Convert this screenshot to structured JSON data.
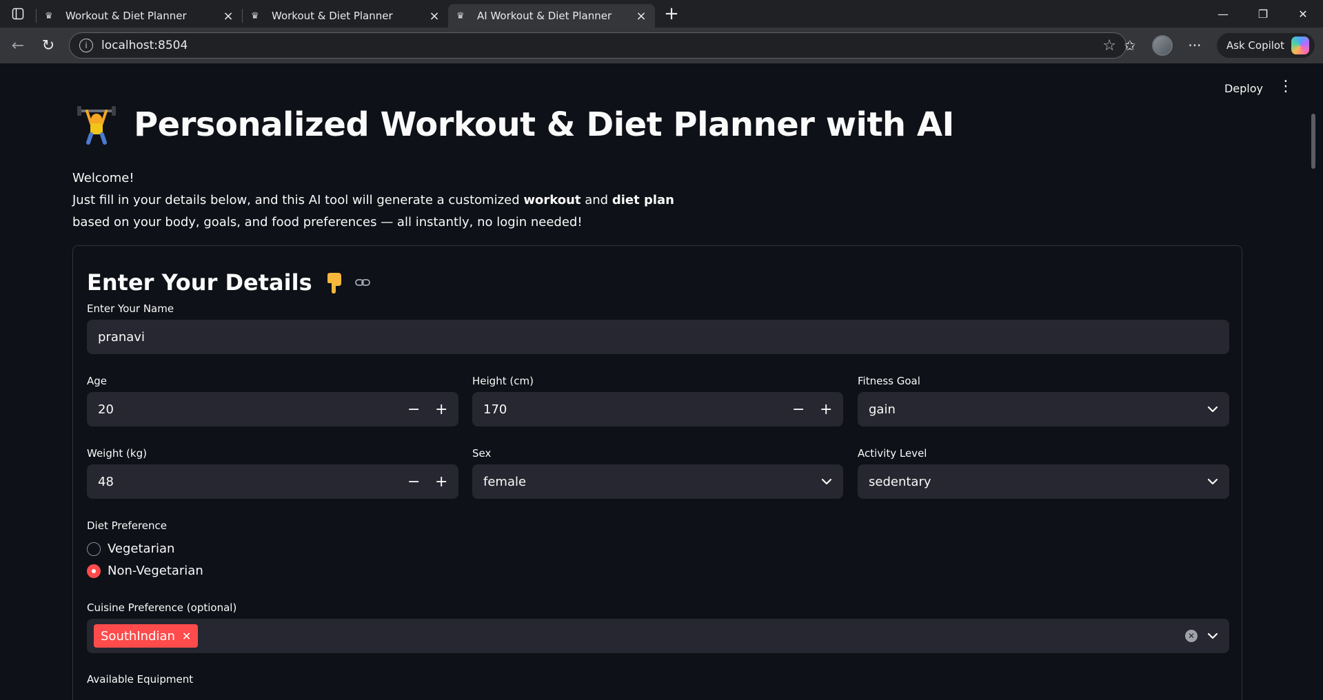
{
  "browser": {
    "tabs": [
      {
        "title": "Workout & Diet Planner",
        "active": false
      },
      {
        "title": "Workout & Diet Planner",
        "active": false
      },
      {
        "title": "AI Workout & Diet Planner",
        "active": true
      }
    ],
    "url": "localhost:8504",
    "copilot_label": "Ask Copilot"
  },
  "app": {
    "deploy_label": "Deploy",
    "title": "Personalized Workout & Diet Planner with AI",
    "intro": {
      "welcome": "Welcome!",
      "line2_a": "Just fill in your details below, and this AI tool will generate a customized ",
      "line2_b": "workout",
      "line2_c": " and ",
      "line2_d": "diet plan",
      "line3": "based on your body, goals, and food preferences — all instantly, no login needed!"
    },
    "form": {
      "section_title": "Enter Your Details",
      "name": {
        "label": "Enter Your Name",
        "value": "pranavi"
      },
      "age": {
        "label": "Age",
        "value": "20"
      },
      "height": {
        "label": "Height (cm)",
        "value": "170"
      },
      "fitness_goal": {
        "label": "Fitness Goal",
        "value": "gain"
      },
      "weight": {
        "label": "Weight (kg)",
        "value": "48"
      },
      "sex": {
        "label": "Sex",
        "value": "female"
      },
      "activity": {
        "label": "Activity Level",
        "value": "sedentary"
      },
      "diet": {
        "label": "Diet Preference",
        "options": [
          "Vegetarian",
          "Non-Vegetarian"
        ],
        "selected": "Non-Vegetarian"
      },
      "cuisine": {
        "label": "Cuisine Preference (optional)",
        "tags": [
          "SouthIndian"
        ]
      },
      "equipment": {
        "label": "Available Equipment"
      }
    }
  },
  "colors": {
    "accent": "#ff4b4b",
    "background": "#0e1117",
    "input_bg": "#262730"
  }
}
